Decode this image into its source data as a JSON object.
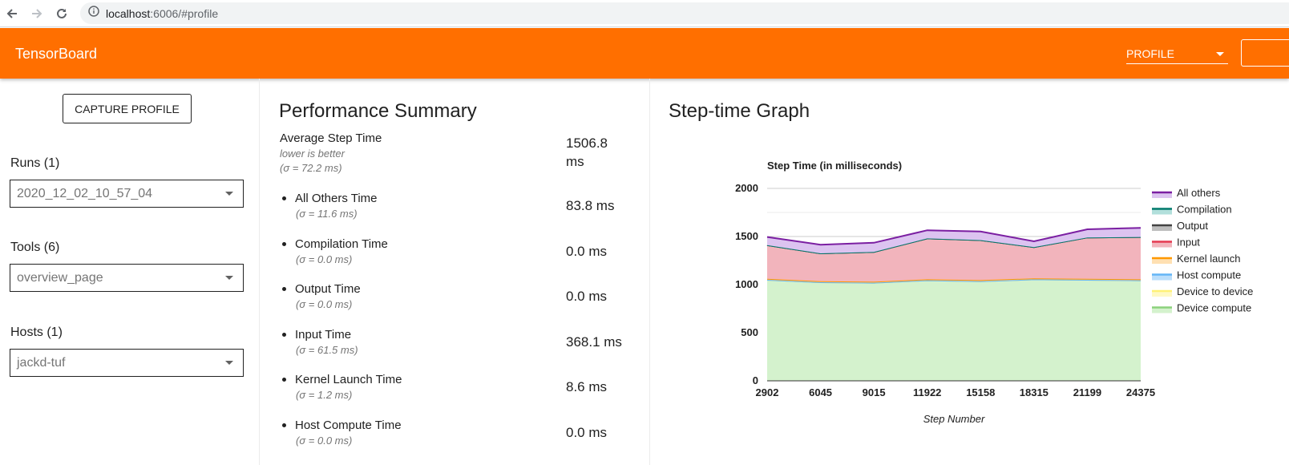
{
  "browser": {
    "url_host": "localhost",
    "url_path": ":6006/#profile"
  },
  "app": {
    "title": "TensorBoard",
    "plugin_selected": "PROFILE",
    "brand_color": "#ff6f00"
  },
  "sidebar": {
    "capture_label": "CAPTURE PROFILE",
    "runs_label": "Runs (1)",
    "runs_value": "2020_12_02_10_57_04",
    "tools_label": "Tools (6)",
    "tools_value": "overview_page",
    "hosts_label": "Hosts (1)",
    "hosts_value": "jackd-tuf"
  },
  "summary": {
    "title": "Performance Summary",
    "avg_label": "Average Step Time",
    "avg_note": "lower is better",
    "avg_sigma": "(σ = 72.2 ms)",
    "avg_value_line1": "1506.8",
    "avg_value_line2": "ms",
    "items": [
      {
        "label": "All Others Time",
        "sigma": "(σ = 11.6 ms)",
        "value": "83.8 ms"
      },
      {
        "label": "Compilation Time",
        "sigma": "(σ = 0.0 ms)",
        "value": "0.0 ms"
      },
      {
        "label": "Output Time",
        "sigma": "(σ = 0.0 ms)",
        "value": "0.0 ms"
      },
      {
        "label": "Input Time",
        "sigma": "(σ = 61.5 ms)",
        "value": "368.1 ms"
      },
      {
        "label": "Kernel Launch Time",
        "sigma": "(σ = 1.2 ms)",
        "value": "8.6 ms"
      },
      {
        "label": "Host Compute Time",
        "sigma": "(σ = 0.0 ms)",
        "value": "0.0 ms"
      }
    ]
  },
  "graph": {
    "title": "Step-time Graph"
  },
  "chart_data": {
    "type": "area",
    "stacked": true,
    "title": "Step Time (in milliseconds)",
    "xlabel": "Step Number",
    "ylabel": "",
    "ylim": [
      0,
      2000
    ],
    "yticks": [
      0,
      500,
      1000,
      1500,
      2000
    ],
    "categories": [
      "2902",
      "6045",
      "9015",
      "11922",
      "15158",
      "18315",
      "21199",
      "24375"
    ],
    "legend_position": "right",
    "series": [
      {
        "name": "Device compute",
        "color": "#8bd17c",
        "fill": "#d4f2cd",
        "values": [
          1050,
          1025,
          1020,
          1045,
          1035,
          1055,
          1050,
          1045
        ]
      },
      {
        "name": "Device to device",
        "color": "#fff176",
        "fill": "#fff9c4",
        "values": [
          0,
          0,
          0,
          0,
          0,
          0,
          0,
          0
        ]
      },
      {
        "name": "Host compute",
        "color": "#64b5f6",
        "fill": "#bbdefb",
        "values": [
          0,
          0,
          0,
          0,
          0,
          0,
          0,
          0
        ]
      },
      {
        "name": "Kernel launch",
        "color": "#ff9800",
        "fill": "#ffe0b2",
        "values": [
          10,
          10,
          10,
          10,
          12,
          10,
          10,
          10
        ]
      },
      {
        "name": "Input",
        "color": "#e53950",
        "fill": "#f2b4bc",
        "values": [
          350,
          290,
          310,
          425,
          415,
          325,
          430,
          440
        ]
      },
      {
        "name": "Output",
        "color": "#424242",
        "fill": "#bdbdbd",
        "values": [
          0,
          0,
          0,
          0,
          0,
          0,
          0,
          0
        ]
      },
      {
        "name": "Compilation",
        "color": "#00796b",
        "fill": "#b2dfdb",
        "values": [
          0,
          0,
          0,
          0,
          0,
          0,
          0,
          0
        ]
      },
      {
        "name": "All others",
        "color": "#7b1fa2",
        "fill": "#dcc3f0",
        "values": [
          85,
          90,
          95,
          85,
          90,
          60,
          85,
          95
        ]
      }
    ]
  }
}
